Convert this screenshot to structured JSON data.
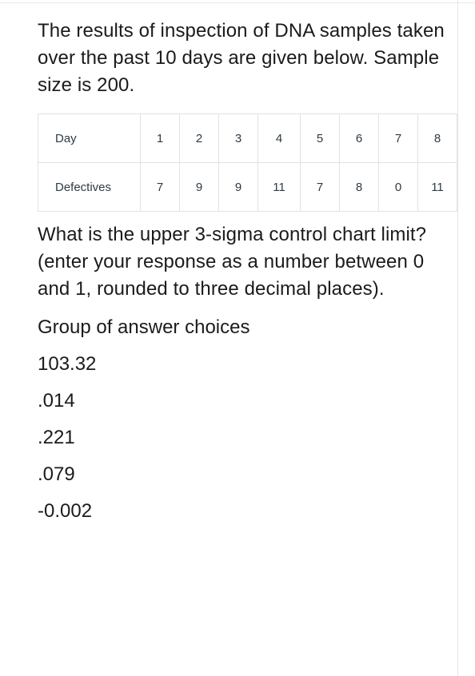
{
  "document": {
    "intro_paragraph": "The results of inspection of DNA samples taken over the past 10 days are given below. Sample size is 200.",
    "question_paragraph": "What is the upper 3-sigma control chart limit? (enter your response as a number between 0 and 1, rounded to three decimal places).",
    "choices_heading": "Group of answer choices"
  },
  "table": {
    "row_labels": [
      "Day",
      "Defectives"
    ],
    "rows": [
      {
        "label": "Day",
        "values": [
          "1",
          "2",
          "3",
          "4",
          "5",
          "6",
          "7",
          "8"
        ]
      },
      {
        "label": "Defectives",
        "values": [
          "7",
          "9",
          "9",
          "11",
          "7",
          "8",
          "0",
          "11"
        ]
      }
    ]
  },
  "answer_choices": [
    {
      "text": "103.32"
    },
    {
      "text": ".014"
    },
    {
      "text": ".221"
    },
    {
      "text": ".079"
    },
    {
      "text": "-0.002"
    }
  ],
  "colors": {
    "body_text": "#1b1b1b",
    "table_text": "#2d3b45",
    "table_border": "#e2e2e2",
    "frame_rule": "#e6e6e6",
    "background": "#ffffff"
  }
}
